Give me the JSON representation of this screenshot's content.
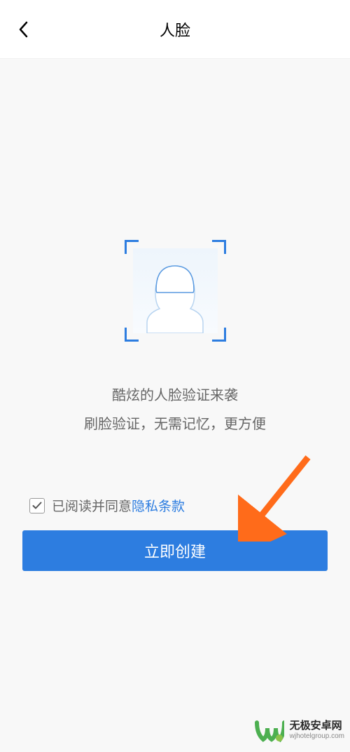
{
  "header": {
    "title": "人脸"
  },
  "main": {
    "desc_line1": "酷炫的人脸验证来袭",
    "desc_line2": "刷脸验证，无需记忆，更方便",
    "agreement_prefix": "已阅读并同意",
    "agreement_link": "隐私条款",
    "create_button": "立即创建"
  },
  "watermark": {
    "name": "无极安卓网",
    "url": "wjhotelgroup.com"
  }
}
